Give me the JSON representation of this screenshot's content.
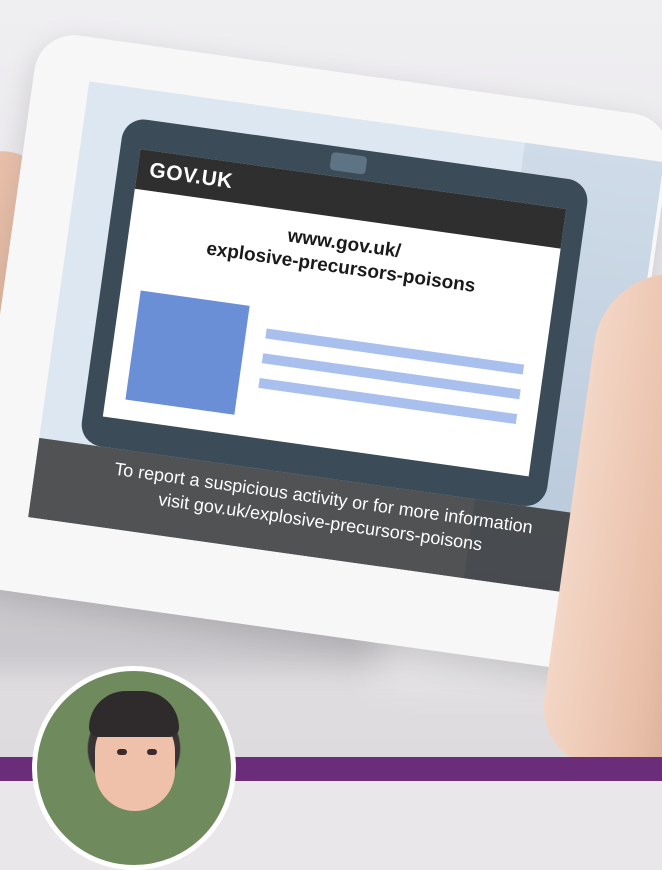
{
  "tablet_screen": {
    "header": {
      "logo_text": "GOV.UK"
    },
    "url": {
      "line1": "www.gov.uk/",
      "line2": "explosive-precursors-poisons"
    },
    "caption": {
      "line1": "To report a suspicious activity or for more information",
      "line2": "visit gov.uk/explosive-precursors-poisons"
    }
  },
  "colors": {
    "gov_header": "#2f2f2f",
    "accent_band": "#6b2c7a",
    "placeholder_image": "#6b8fd6",
    "placeholder_lines": "#a9c0ee"
  },
  "avatar": {
    "icon": "person-portrait"
  }
}
